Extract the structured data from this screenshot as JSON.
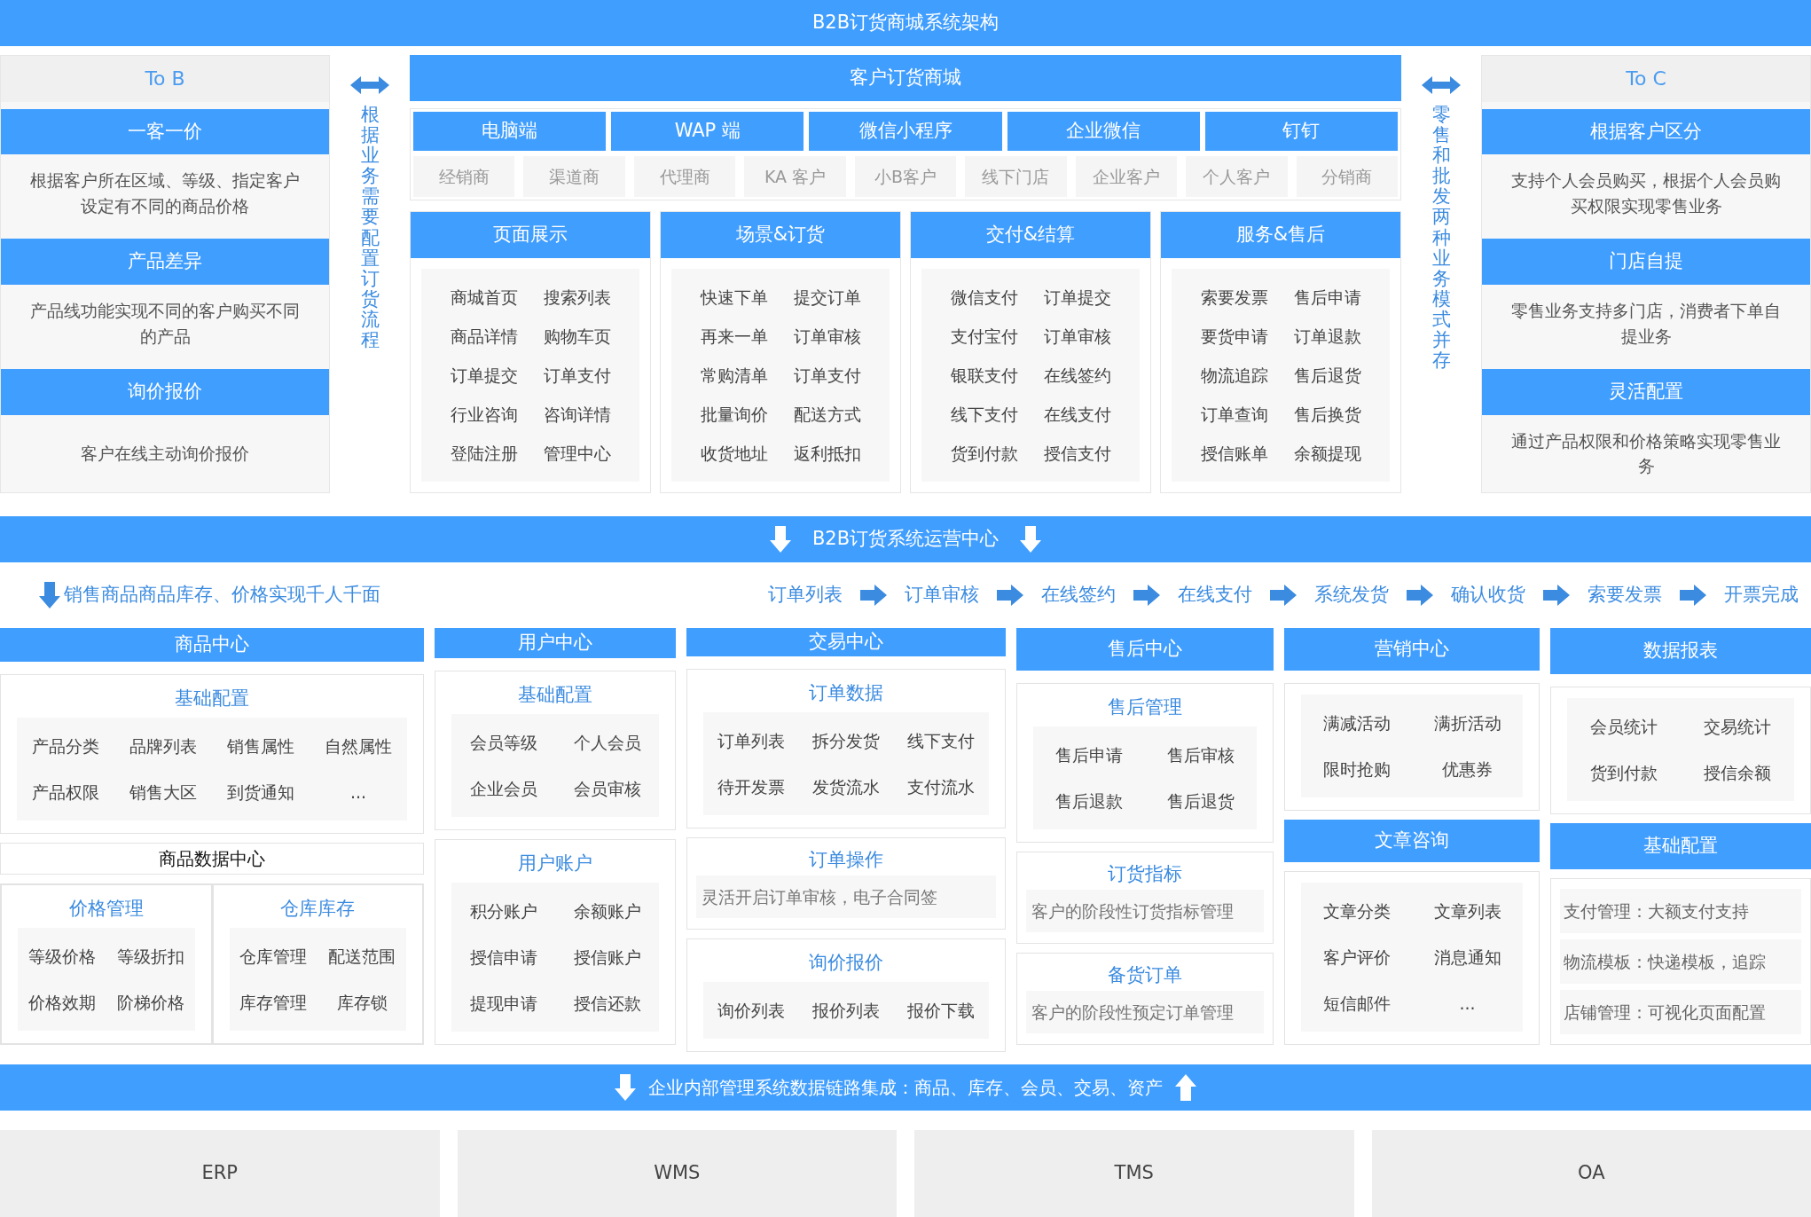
{
  "title": "B2B订货商城系统架构",
  "to_b": {
    "heading": "To B",
    "sections": [
      {
        "title": "一客一价",
        "text": "根据客户所在区域、等级、指定客户设定有不同的商品价格"
      },
      {
        "title": "产品差异",
        "text": "产品线功能实现不同的客户购买不同的产品"
      },
      {
        "title": "询价报价",
        "text": "客户在线主动询价报价"
      }
    ]
  },
  "left_connector": {
    "text": "根据业务需要配置订货流程"
  },
  "mall": {
    "title": "客户订货商城",
    "channels": [
      "电脑端",
      "WAP 端",
      "微信小程序",
      "企业微信",
      "钉钉"
    ],
    "customer_types": [
      "经销商",
      "渠道商",
      "代理商",
      "KA 客户",
      "小B客户",
      "线下门店",
      "企业客户",
      "个人客户",
      "分销商"
    ],
    "modules": [
      {
        "title": "页面展示",
        "items": [
          "商城首页",
          "搜索列表",
          "商品详情",
          "购物车页",
          "订单提交",
          "订单支付",
          "行业咨询",
          "咨询详情",
          "登陆注册",
          "管理中心"
        ]
      },
      {
        "title": "场景&订货",
        "items": [
          "快速下单",
          "提交订单",
          "再来一单",
          "订单审核",
          "常购清单",
          "订单支付",
          "批量询价",
          "配送方式",
          "收货地址",
          "返利抵扣"
        ]
      },
      {
        "title": "交付&结算",
        "items": [
          "微信支付",
          "订单提交",
          "支付宝付",
          "订单审核",
          "银联支付",
          "在线签约",
          "线下支付",
          "在线支付",
          "货到付款",
          "授信支付"
        ]
      },
      {
        "title": "服务&售后",
        "items": [
          "索要发票",
          "售后申请",
          "要货申请",
          "订单退款",
          "物流追踪",
          "售后退货",
          "订单查询",
          "售后换货",
          "授信账单",
          "余额提现"
        ]
      }
    ]
  },
  "right_connector": {
    "text": "零售和批发两种业务模式并存"
  },
  "to_c": {
    "heading": "To C",
    "sections": [
      {
        "title": "根据客户区分",
        "text": "支持个人会员购买，根据个人会员购买权限实现零售业务"
      },
      {
        "title": "门店自提",
        "text": "零售业务支持多门店，消费者下单自提业务"
      },
      {
        "title": "灵活配置",
        "text": "通过产品权限和价格策略实现零售业务"
      }
    ]
  },
  "operations_bar": {
    "title": "B2B订货系统运营中心"
  },
  "inventory_note": "销售商品商品库存、价格实现千人千面",
  "order_flow": [
    "订单列表",
    "订单审核",
    "在线签约",
    "在线支付",
    "系统发货",
    "确认收货",
    "索要发票",
    "开票完成"
  ],
  "centers": [
    {
      "title": "商品中心",
      "blocks": [
        {
          "kind": "grid",
          "title": "基础配置",
          "rows": [
            [
              "产品分类",
              "品牌列表",
              "销售属性",
              "自然属性"
            ],
            [
              "产品权限",
              "销售大区",
              "到货通知",
              "..."
            ]
          ]
        },
        {
          "kind": "label",
          "text": "商品数据中心"
        },
        {
          "kind": "split",
          "parts": [
            {
              "title": "价格管理",
              "rows": [
                [
                  "等级价格",
                  "等级折扣"
                ],
                [
                  "价格效期",
                  "阶梯价格"
                ]
              ]
            },
            {
              "title": "仓库库存",
              "rows": [
                [
                  "仓库管理",
                  "配送范围"
                ],
                [
                  "库存管理",
                  "库存锁"
                ]
              ]
            }
          ]
        }
      ]
    },
    {
      "title": "用户中心",
      "blocks": [
        {
          "kind": "grid",
          "title": "基础配置",
          "rows": [
            [
              "会员等级",
              "个人会员"
            ],
            [
              "企业会员",
              "会员审核"
            ]
          ]
        },
        {
          "kind": "grid",
          "title": "用户账户",
          "rows": [
            [
              "积分账户",
              "余额账户"
            ],
            [
              "授信申请",
              "授信账户"
            ],
            [
              "提现申请",
              "授信还款"
            ]
          ]
        }
      ]
    },
    {
      "title": "交易中心",
      "blocks": [
        {
          "kind": "grid",
          "title": "订单数据",
          "rows": [
            [
              "订单列表",
              "拆分发货",
              "线下支付"
            ],
            [
              "待开发票",
              "发货流水",
              "支付流水"
            ]
          ]
        },
        {
          "kind": "note",
          "title": "订单操作",
          "text": "灵活开启订单审核，电子合同签"
        },
        {
          "kind": "grid",
          "title": "询价报价",
          "rows": [
            [
              "询价列表",
              "报价列表",
              "报价下载"
            ]
          ]
        }
      ]
    },
    {
      "title": "售后中心",
      "blocks": [
        {
          "kind": "grid",
          "title": "售后管理",
          "rows": [
            [
              "售后申请",
              "售后审核"
            ],
            [
              "售后退款",
              "售后退货"
            ]
          ]
        },
        {
          "kind": "note",
          "title": "订货指标",
          "text": "客户的阶段性订货指标管理"
        },
        {
          "kind": "note",
          "title": "备货订单",
          "text": "客户的阶段性预定订单管理"
        }
      ]
    },
    {
      "title": "营销中心",
      "blocks": [
        {
          "kind": "grid",
          "rows": [
            [
              "满减活动",
              "满折活动"
            ],
            [
              "限时抢购",
              "优惠券"
            ]
          ]
        },
        {
          "kind": "header",
          "text": "文章咨询"
        },
        {
          "kind": "grid",
          "rows": [
            [
              "文章分类",
              "文章列表"
            ],
            [
              "客户评价",
              "消息通知"
            ],
            [
              "短信邮件",
              "..."
            ]
          ]
        }
      ]
    },
    {
      "title": "数据报表",
      "blocks": [
        {
          "kind": "grid",
          "rows": [
            [
              "会员统计",
              "交易统计"
            ],
            [
              "货到付款",
              "授信余额"
            ]
          ]
        },
        {
          "kind": "header",
          "text": "基础配置"
        },
        {
          "kind": "list",
          "items": [
            "支付管理：大额支付支持",
            "物流模板：快递模板，追踪",
            "店铺管理：可视化页面配置"
          ]
        }
      ]
    }
  ],
  "integration_bar": {
    "text": "企业内部管理系统数据链路集成：商品、库存、会员、交易、资产"
  },
  "systems": [
    "ERP",
    "WMS",
    "TMS",
    "OA"
  ]
}
